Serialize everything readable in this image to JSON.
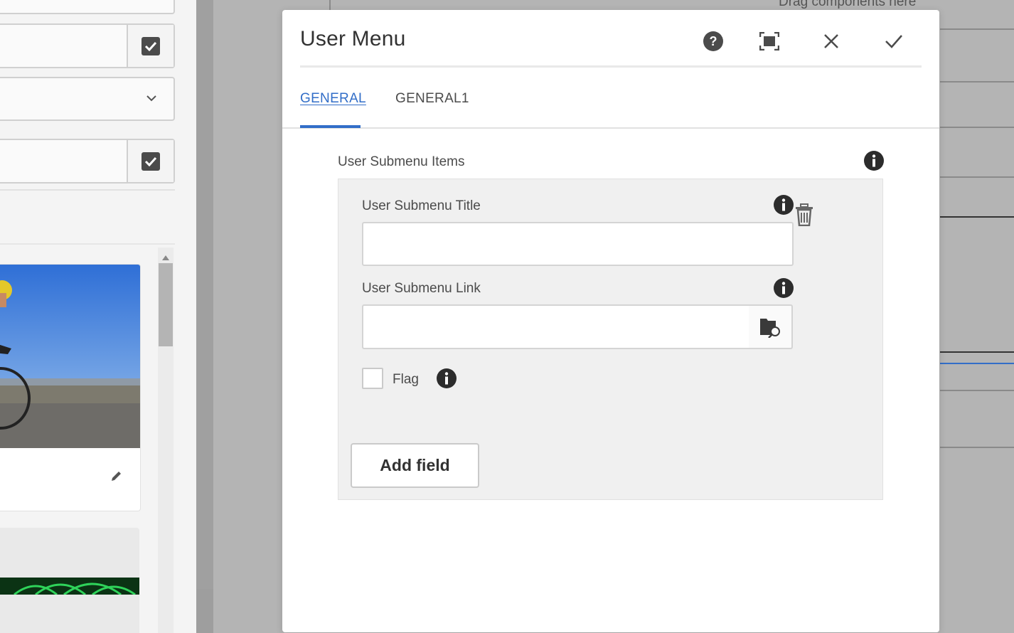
{
  "editor": {
    "drag_hint": "Drag components here"
  },
  "dialog": {
    "title": "User Menu",
    "header_icons": [
      "help-icon",
      "fullscreen-icon",
      "close-icon",
      "done-checkmark-icon"
    ],
    "tabs": [
      {
        "label": "GENERAL",
        "active": true
      },
      {
        "label": "GENERAL1",
        "active": false
      }
    ],
    "multifield": {
      "label": "User Submenu Items",
      "fields": {
        "title_label": "User Submenu Title",
        "title_value": "",
        "link_label": "User Submenu Link",
        "link_value": "",
        "flag_label": "Flag",
        "flag_checked": false
      },
      "add_label": "Add field"
    }
  },
  "colors": {
    "accent": "#326ec8",
    "overlay": "#b4b4b4"
  }
}
